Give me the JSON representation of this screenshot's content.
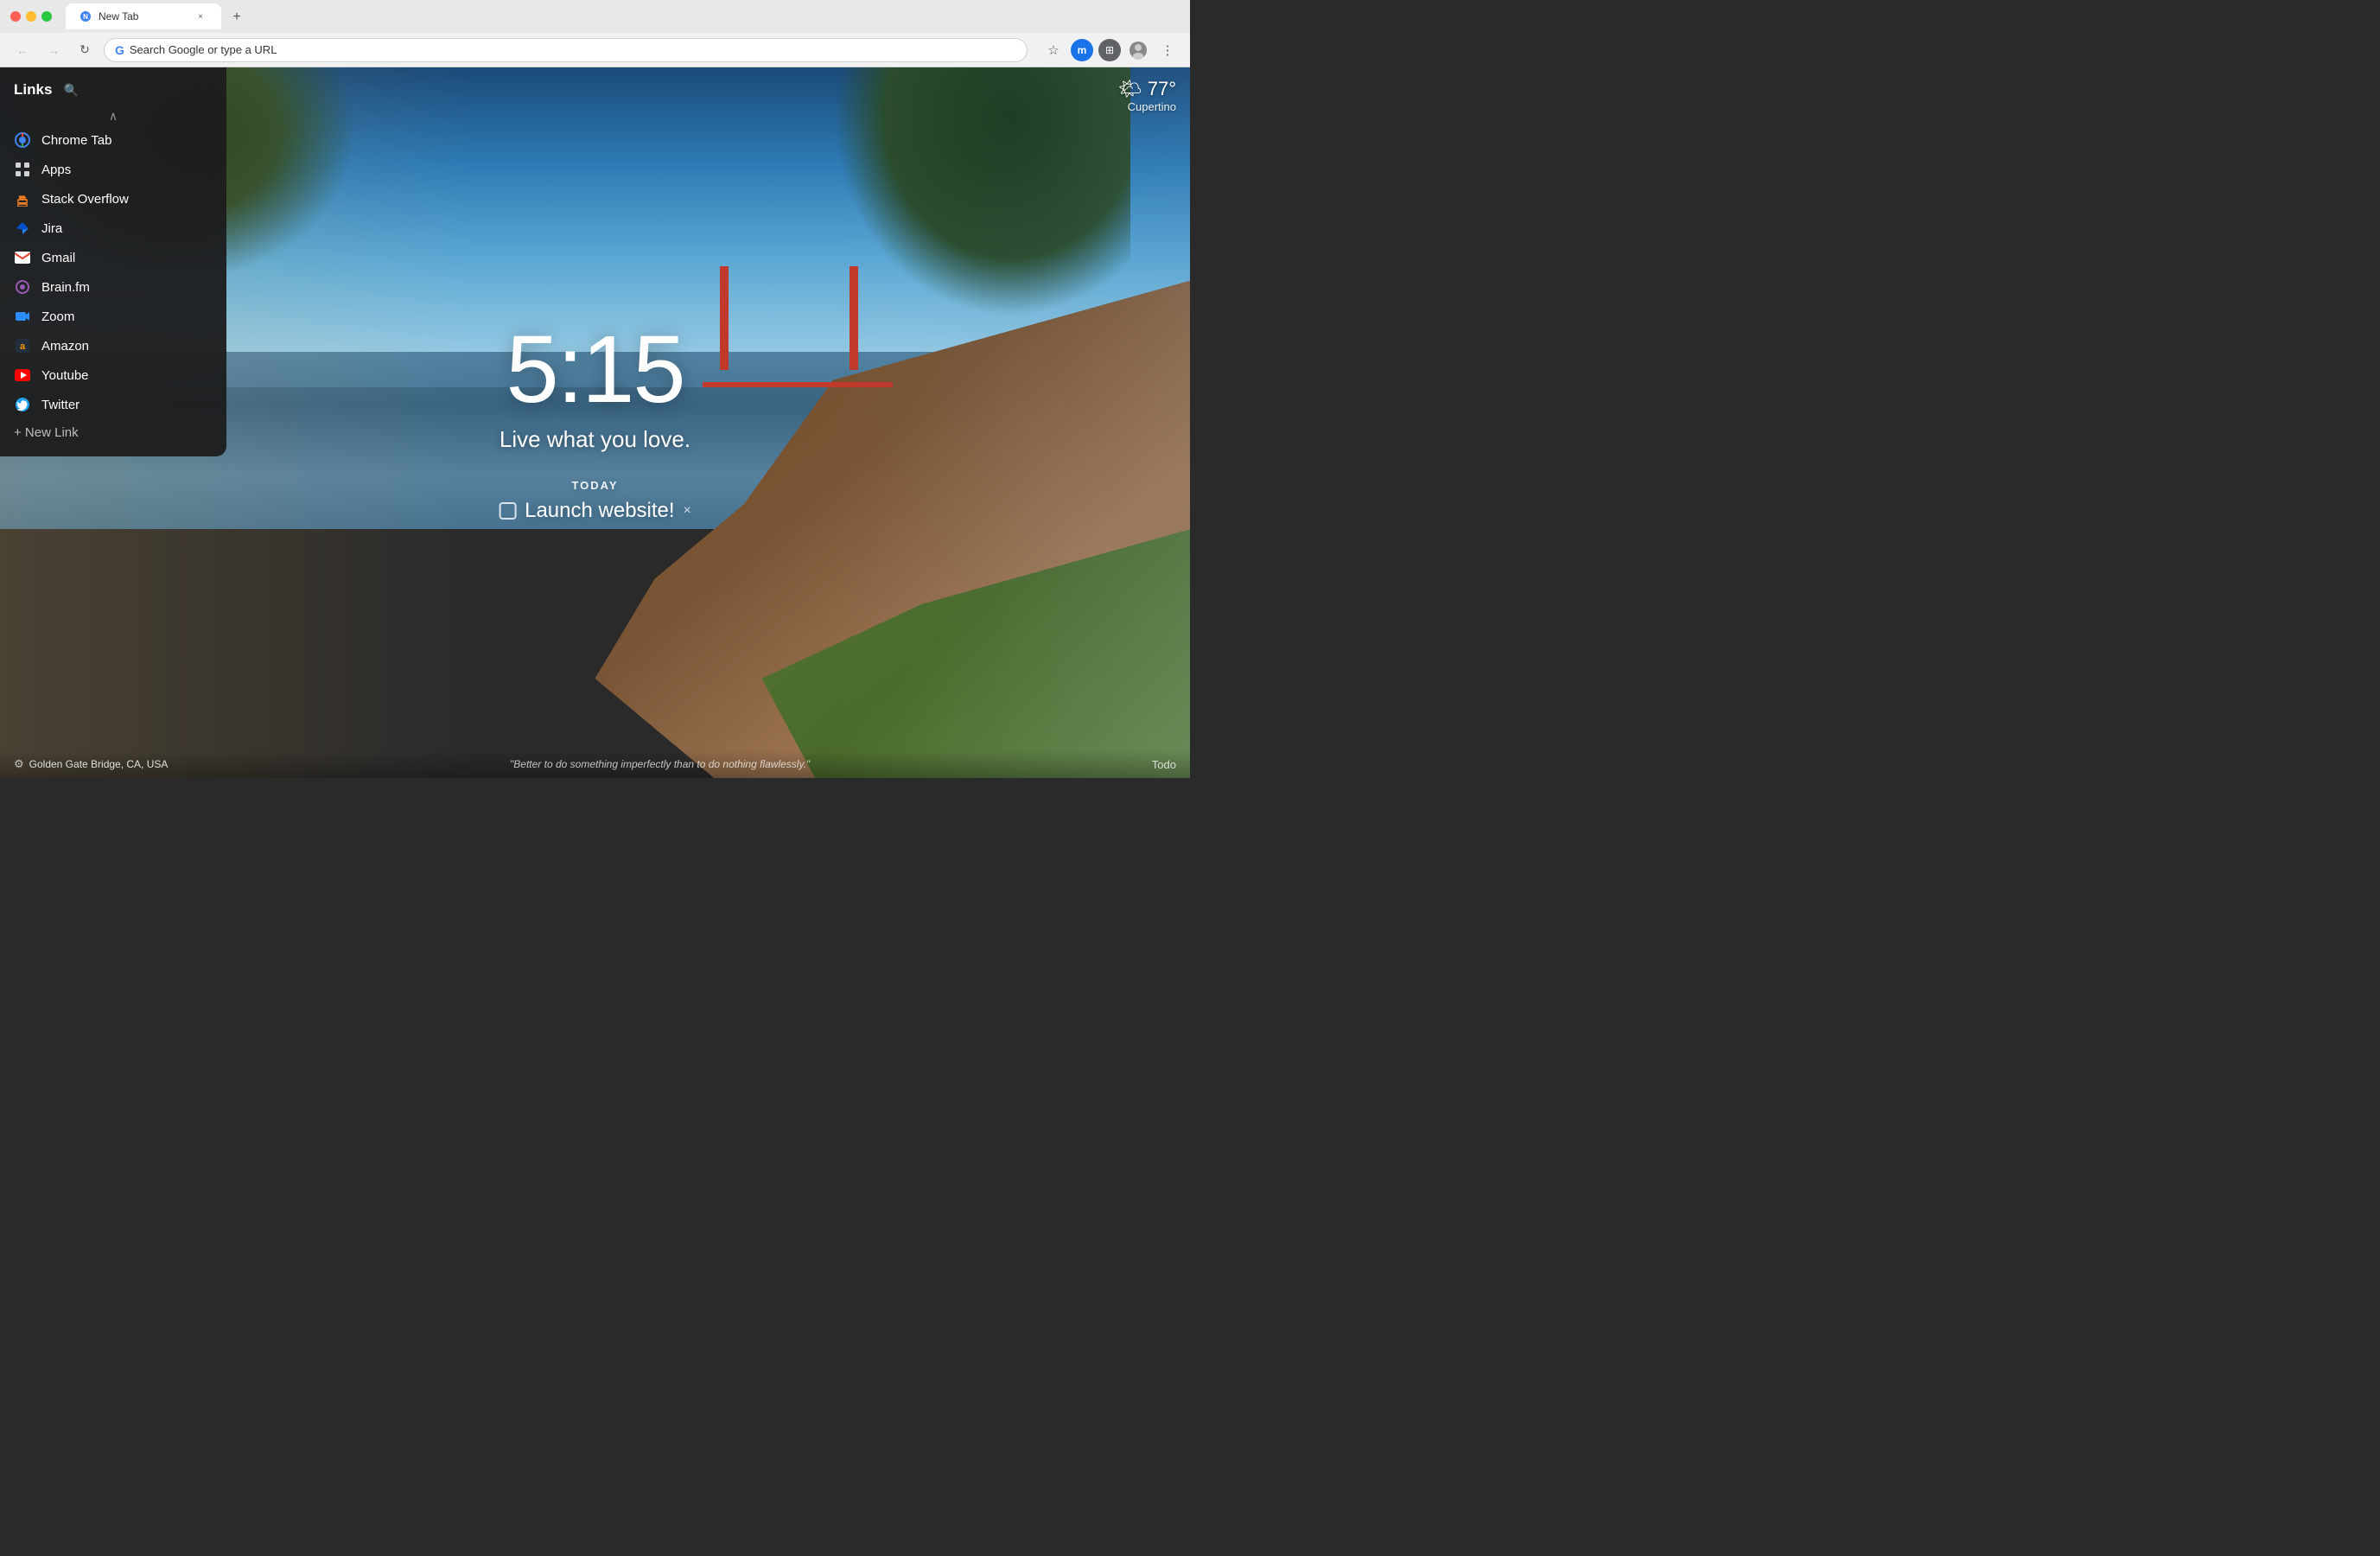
{
  "browser": {
    "tab_title": "New Tab",
    "address_placeholder": "Search Google or type a URL",
    "address_text": "Search Google or type a URL",
    "new_tab_icon": "+",
    "back_icon": "←",
    "forward_icon": "→",
    "reload_icon": "↻",
    "star_icon": "☆",
    "user_initial": "m",
    "tab_close": "×"
  },
  "page": {
    "time": "5:15",
    "motto": "Live what you love.",
    "today_label": "TODAY",
    "todo_text": "Launch website!",
    "todo_close": "×"
  },
  "weather": {
    "temp": "77°",
    "location": "Cupertino",
    "icon": "🌤"
  },
  "links": {
    "title": "Links",
    "search_icon": "🔍",
    "chevron": "∧",
    "items": [
      {
        "label": "Chrome Tab",
        "icon": "⬤",
        "icon_class": "icon-chrome",
        "icon_text": "◉"
      },
      {
        "label": "Apps",
        "icon": "⊞",
        "icon_class": "icon-apps",
        "icon_text": "⋯"
      },
      {
        "label": "Stack Overflow",
        "icon": "🟠",
        "icon_class": "icon-so",
        "icon_text": "≡"
      },
      {
        "label": "Jira",
        "icon": "△",
        "icon_class": "icon-jira",
        "icon_text": "▲"
      },
      {
        "label": "Gmail",
        "icon": "M",
        "icon_class": "icon-gmail",
        "icon_text": "M"
      },
      {
        "label": "Brain.fm",
        "icon": "●",
        "icon_class": "icon-brain",
        "icon_text": "◈"
      },
      {
        "label": "Zoom",
        "icon": "Z",
        "icon_class": "icon-zoom",
        "icon_text": "▪"
      },
      {
        "label": "Amazon",
        "icon": "a",
        "icon_class": "icon-amazon",
        "icon_text": "a"
      },
      {
        "label": "Youtube",
        "icon": "▶",
        "icon_class": "icon-youtube",
        "icon_text": "▶"
      },
      {
        "label": "Twitter",
        "icon": "t",
        "icon_class": "icon-twitter",
        "icon_text": "t"
      }
    ],
    "add_label": "+ New Link"
  },
  "footer": {
    "location": "Golden Gate Bridge, CA, USA",
    "quote": "\"Better to do something imperfectly than to do nothing flawlessly.\"",
    "todo_label": "Todo"
  }
}
